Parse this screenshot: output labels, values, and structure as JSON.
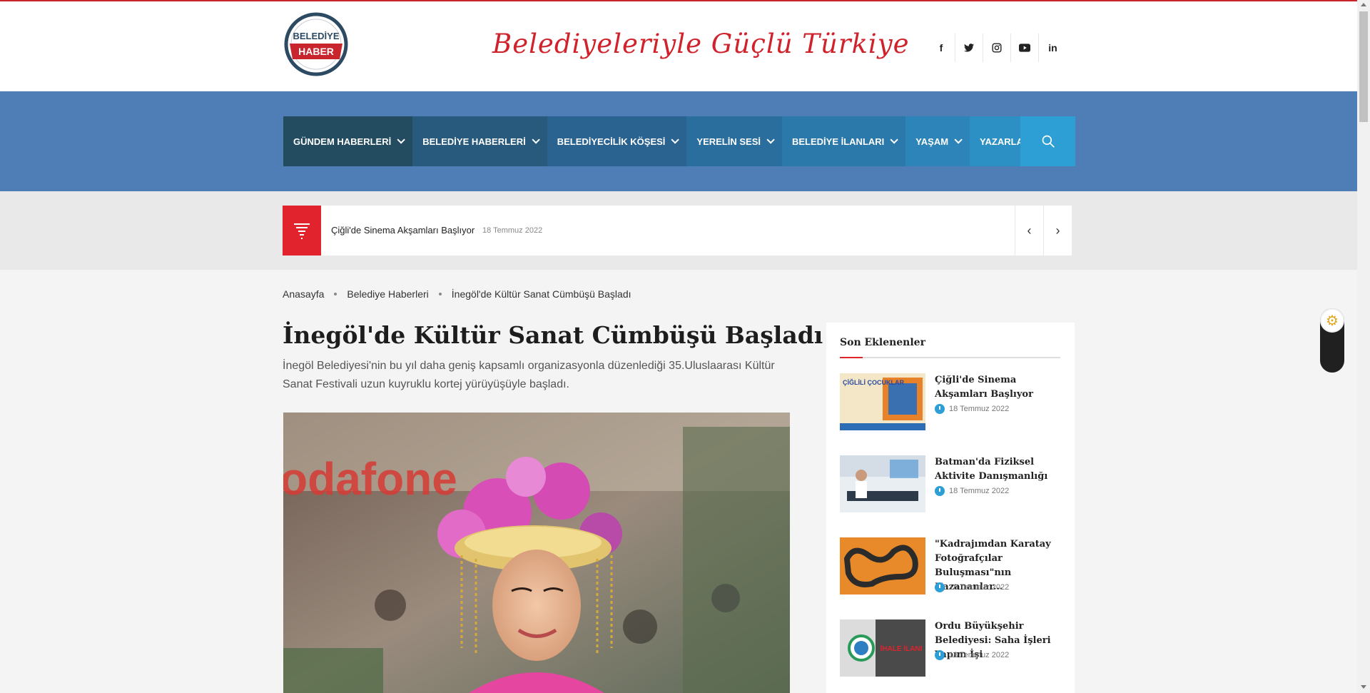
{
  "header": {
    "logo": {
      "line1": "BELEDİYE",
      "line2": "HABER"
    },
    "slogan": "Belediyeleriyle Güçlü Türkiye",
    "social": [
      {
        "icon": "facebook-icon",
        "glyph": "f"
      },
      {
        "icon": "twitter-icon",
        "glyph": "t"
      },
      {
        "icon": "instagram-icon",
        "glyph": "◎"
      },
      {
        "icon": "youtube-icon",
        "glyph": "▶"
      },
      {
        "icon": "linkedin-icon",
        "glyph": "in"
      }
    ]
  },
  "nav": {
    "items": [
      {
        "label": "GÜNDEM HABERLERİ",
        "color": "#234c61",
        "dropdown": true
      },
      {
        "label": "BELEDİYE HABERLERİ",
        "color": "#275a7c",
        "dropdown": true
      },
      {
        "label": "BELEDİYECİLİK KÖŞESİ",
        "color": "#2b6390",
        "dropdown": true
      },
      {
        "label": "YERELİN SESİ",
        "color": "#2a6e9d",
        "dropdown": true
      },
      {
        "label": "BELEDİYE İLANLARI",
        "color": "#2b79aa",
        "dropdown": true
      },
      {
        "label": "YAŞAM",
        "color": "#2c84b8",
        "dropdown": true
      },
      {
        "label": "YAZARLAR",
        "color": "#2c90c5",
        "dropdown": false
      }
    ]
  },
  "ticker": {
    "title": "Çiğli'de Sinema Akşamları Başlıyor",
    "date": "18 Temmuz 2022"
  },
  "breadcrumb": [
    "Anasayfa",
    "Belediye Haberleri",
    "İnegöl'de Kültür Sanat Cümbüşü Başladı"
  ],
  "article": {
    "title": "İnegöl'de Kültür Sanat Cümbüşü Başladı",
    "lead": "İnegöl Belediyesi'nin bu yıl daha geniş kapsamlı organizasyonla düzenlediği 35.Uluslaarası Kültür Sanat Festivali uzun kuyruklu kortej yürüyüşüyle başladı.",
    "hero_text": "odafone"
  },
  "sidebar": {
    "heading": "Son Eklenenler",
    "posts": [
      {
        "title": "Çiğli'de Sinema Akşamları Başlıyor",
        "date": "18 Temmuz 2022",
        "thumb_text": "ÇİĞLİLİ ÇOCUKLAR"
      },
      {
        "title": "Batman'da Fiziksel Aktivite Danışmanlığı",
        "date": "18 Temmuz 2022",
        "thumb_text": ""
      },
      {
        "title": "\"Kadrajımdan Karatay Fotoğrafçılar Buluşması\"nın Kazananlar...",
        "date": "18 Temmuz 2022",
        "thumb_text": ""
      },
      {
        "title": "Ordu Büyükşehir Belediyesi: Saha İşleri Yapım İşi",
        "date": "18 Temmuz 2022",
        "thumb_text": "İHALE İLANI"
      }
    ]
  },
  "colors": {
    "accent_red": "#e0232d",
    "nav_bg": "#4e7eb5",
    "search_bg": "#2d9fd4"
  }
}
